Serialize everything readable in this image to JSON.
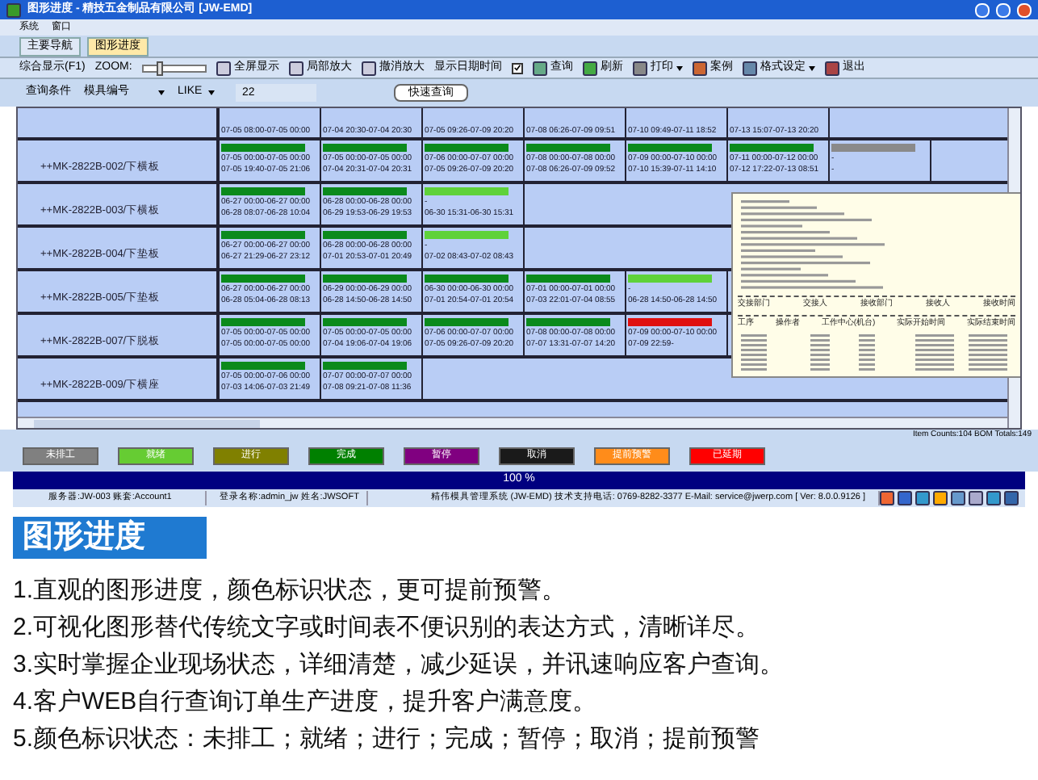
{
  "window": {
    "title": "图形进度 - 精技五金制品有限公司 [JW-EMD]"
  },
  "menu": [
    "系统",
    "窗口"
  ],
  "tabs": [
    {
      "label": "主要导航",
      "selected": false
    },
    {
      "label": "图形进度",
      "selected": true
    }
  ],
  "toolbar": {
    "view": "综合显示(F1)",
    "zoom_label": "ZOOM:",
    "zoom": {
      "level": 0.25
    },
    "buttons": [
      {
        "label": "全屏显示"
      },
      {
        "label": "局部放大"
      },
      {
        "label": "撤消放大"
      }
    ],
    "show_datetime": {
      "label": "显示日期时间",
      "checked": true
    },
    "actions": [
      {
        "label": "查询",
        "dropdown": false
      },
      {
        "label": "刷新",
        "dropdown": false
      },
      {
        "label": "打印",
        "dropdown": true
      },
      {
        "label": "案例",
        "dropdown": false
      },
      {
        "label": "格式设定",
        "dropdown": true
      },
      {
        "label": "退出",
        "dropdown": false
      }
    ]
  },
  "query": {
    "label": "查询条件",
    "field": "模具编号",
    "operator": "LIKE",
    "value": "22",
    "button": "快速查询"
  },
  "grid": {
    "rows": [
      {
        "name": "",
        "cells": [
          {
            "times": [
              "07-05 08:00-07-05 00:00"
            ]
          },
          {
            "times": [
              "07-04 20:30-07-04 20:30"
            ]
          },
          {
            "times": [
              "07-05 09:26-07-09 20:20"
            ]
          },
          {
            "times": [
              "07-08 06:26-07-09 09:51"
            ]
          },
          {
            "times": [
              "07-10 09:49-07-11 18:52"
            ]
          },
          {
            "times": [
              "07-13 15:07-07-13 20:20"
            ]
          }
        ]
      },
      {
        "name": "++MK-2822B-002/下横板",
        "cells": [
          {
            "color": "#0b8a1c",
            "times": [
              "07-05 00:00-07-05 00:00",
              "07-05 19:40-07-05 21:06"
            ]
          },
          {
            "color": "#0b8a1c",
            "times": [
              "07-05 00:00-07-05 00:00",
              "07-04 20:31-07-04 20:31"
            ]
          },
          {
            "color": "#0b8a1c",
            "times": [
              "07-06 00:00-07-07 00:00",
              "07-05 09:26-07-09 20:20"
            ]
          },
          {
            "color": "#0b8a1c",
            "times": [
              "07-08 00:00-07-08 00:00",
              "07-08 06:26-07-09 09:52"
            ]
          },
          {
            "color": "#0b8a1c",
            "times": [
              "07-09 00:00-07-10 00:00",
              "07-10 15:39-07-11 14:10"
            ]
          },
          {
            "color": "#0b8a1c",
            "times": [
              "07-11 00:00-07-12 00:00",
              "07-12 17:22-07-13 08:51"
            ]
          },
          {
            "color": "#8a8a8a",
            "times": [
              "-",
              "-"
            ]
          }
        ]
      },
      {
        "name": "++MK-2822B-003/下横板",
        "cells": [
          {
            "color": "#0b8a1c",
            "times": [
              "06-27 00:00-06-27 00:00",
              "06-28 08:07-06-28 10:04"
            ]
          },
          {
            "color": "#0b8a1c",
            "times": [
              "06-28 00:00-06-28 00:00",
              "06-29 19:53-06-29 19:53"
            ]
          },
          {
            "color": "#5fd23a",
            "times": [
              "-",
              "06-30 15:31-06-30 15:31"
            ]
          }
        ]
      },
      {
        "name": "++MK-2822B-004/下垫板",
        "cells": [
          {
            "color": "#0b8a1c",
            "times": [
              "06-27 00:00-06-27 00:00",
              "06-27 21:29-06-27 23:12"
            ]
          },
          {
            "color": "#0b8a1c",
            "times": [
              "06-28 00:00-06-28 00:00",
              "07-01 20:53-07-01 20:49"
            ]
          },
          {
            "color": "#5fd23a",
            "times": [
              "-",
              "07-02 08:43-07-02 08:43"
            ]
          }
        ]
      },
      {
        "name": "++MK-2822B-005/下垫板",
        "cells": [
          {
            "color": "#0b8a1c",
            "times": [
              "06-27 00:00-06-27 00:00",
              "06-28 05:04-06-28 08:13"
            ]
          },
          {
            "color": "#0b8a1c",
            "times": [
              "06-29 00:00-06-29 00:00",
              "06-28 14:50-06-28 14:50"
            ]
          },
          {
            "color": "#0b8a1c",
            "times": [
              "06-30 00:00-06-30 00:00",
              "07-01 20:54-07-01 20:54"
            ]
          },
          {
            "color": "#0b8a1c",
            "times": [
              "07-01 00:00-07-01 00:00",
              "07-03 22:01-07-04 08:55"
            ]
          },
          {
            "color": "#5fd23a",
            "times": [
              "-",
              "06-28 14:50-06-28 14:50"
            ]
          }
        ]
      },
      {
        "name": "++MK-2822B-007/下脱板",
        "cells": [
          {
            "color": "#0b8a1c",
            "times": [
              "07-05 00:00-07-05 00:00",
              "07-05 00:00-07-05 00:00"
            ]
          },
          {
            "color": "#0b8a1c",
            "times": [
              "07-05 00:00-07-05 00:00",
              "07-04 19:06-07-04 19:06"
            ]
          },
          {
            "color": "#0b8a1c",
            "times": [
              "07-06 00:00-07-07 00:00",
              "07-05 09:26-07-09 20:20"
            ]
          },
          {
            "color": "#0b8a1c",
            "times": [
              "07-08 00:00-07-08 00:00",
              "07-07 13:31-07-07 14:20"
            ]
          },
          {
            "color": "#e01010",
            "times": [
              "07-09 00:00-07-10 00:00",
              "07-09 22:59-"
            ]
          }
        ]
      },
      {
        "name": "++MK-2822B-009/下横座",
        "cells": [
          {
            "color": "#0b8a1c",
            "times": [
              "07-05 00:00-07-06 00:00",
              "07-03 14:06-07-03 21:49"
            ]
          },
          {
            "color": "#0b8a1c",
            "times": [
              "07-07 00:00-07-07 00:00",
              "07-08 09:21-07-08 11:36"
            ]
          }
        ]
      }
    ]
  },
  "tooltip": {
    "handover_headers": [
      "交接部门",
      "交接人",
      "接收部门",
      "接收人",
      "接收时间"
    ],
    "process_headers": [
      "工序",
      "操作者",
      "工作中心(机台)",
      "实际开始时间",
      "实际结束时间"
    ]
  },
  "counts": "Item Counts:104  BOM Totals:149",
  "legend": [
    {
      "label": "未排工",
      "color": "#808080"
    },
    {
      "label": "就绪",
      "color": "#66cc33"
    },
    {
      "label": "进行",
      "color": "#808000"
    },
    {
      "label": "完成",
      "color": "#008000"
    },
    {
      "label": "暂停",
      "color": "#800080"
    },
    {
      "label": "取消",
      "color": "#1a1a1a"
    },
    {
      "label": "提前预警",
      "color": "#ff8c1a"
    },
    {
      "label": "已延期",
      "color": "#ff0000"
    }
  ],
  "progress": {
    "level": 1,
    "reading": "100 %"
  },
  "status_bar": [
    "服务器:JW-003   账套:Account1",
    "登录名称:admin_jw  姓名:JWSOFT",
    "精伟模具管理系统 (JW-EMD)   技术支持电话: 0769-8282-3377  E-Mail: service@jwerp.com  [ Ver: 8.0.0.9126 ]"
  ],
  "feature": {
    "heading": "图形进度",
    "points": [
      "1.直观的图形进度，颜色标识状态，更可提前预警。",
      "2.可视化图形替代传统文字或时间表不便识别的表达方式，清晰详尽。",
      "3.实时掌握企业现场状态，详细清楚，减少延误，并讯速响应客户查询。",
      "4.客户WEB自行查询订单生产进度，提升客户满意度。",
      "5.颜色标识状态：未排工；就绪；进行；完成；暂停；取消；提前预警"
    ]
  }
}
